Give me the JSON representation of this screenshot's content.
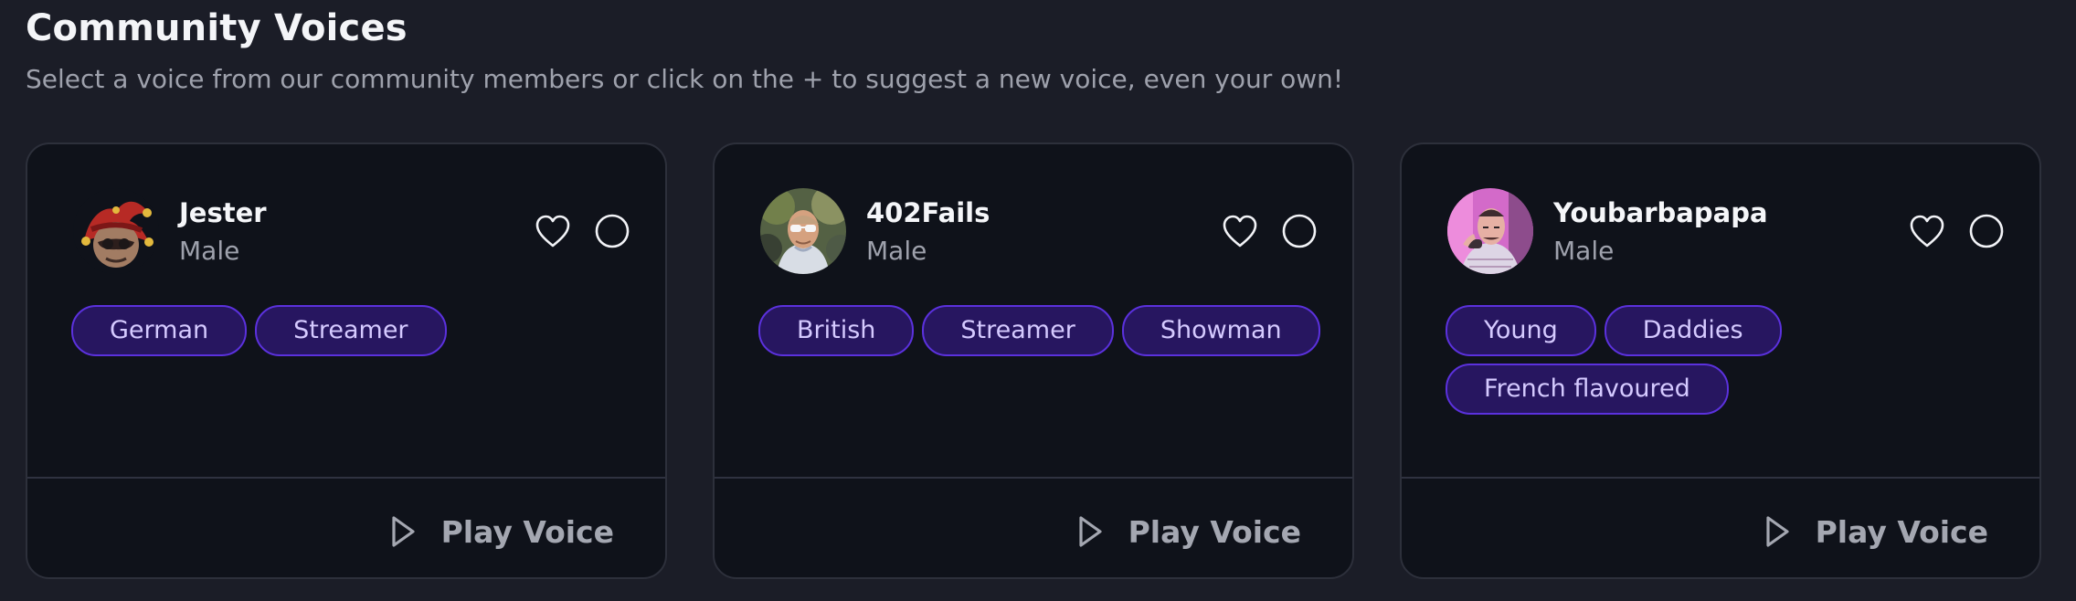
{
  "header": {
    "title": "Community Voices",
    "subtitle": "Select a voice from our community members or click on the + to suggest a new voice, even your own!"
  },
  "cards": [
    {
      "name": "Jester",
      "gender": "Male",
      "avatar": "jester-avatar",
      "tags": [
        "German",
        "Streamer"
      ],
      "play_label": "Play Voice"
    },
    {
      "name": "402Fails",
      "gender": "Male",
      "avatar": "402fails-avatar",
      "tags": [
        "British",
        "Streamer",
        "Showman"
      ],
      "play_label": "Play Voice"
    },
    {
      "name": "Youbarbapapa",
      "gender": "Male",
      "avatar": "youbarbapapa-avatar",
      "tags": [
        "Young",
        "Daddies",
        "French flavoured"
      ],
      "play_label": "Play Voice"
    }
  ],
  "icons": {
    "favorite": "heart-icon",
    "select": "radio-circle-icon",
    "play": "play-icon"
  },
  "colors": {
    "background": "#1b1d27",
    "card": "#0f121a",
    "tag_fill": "#271660",
    "tag_border": "#5b31dd",
    "tag_text": "#d5caff",
    "muted_text": "#9ea1ac"
  }
}
